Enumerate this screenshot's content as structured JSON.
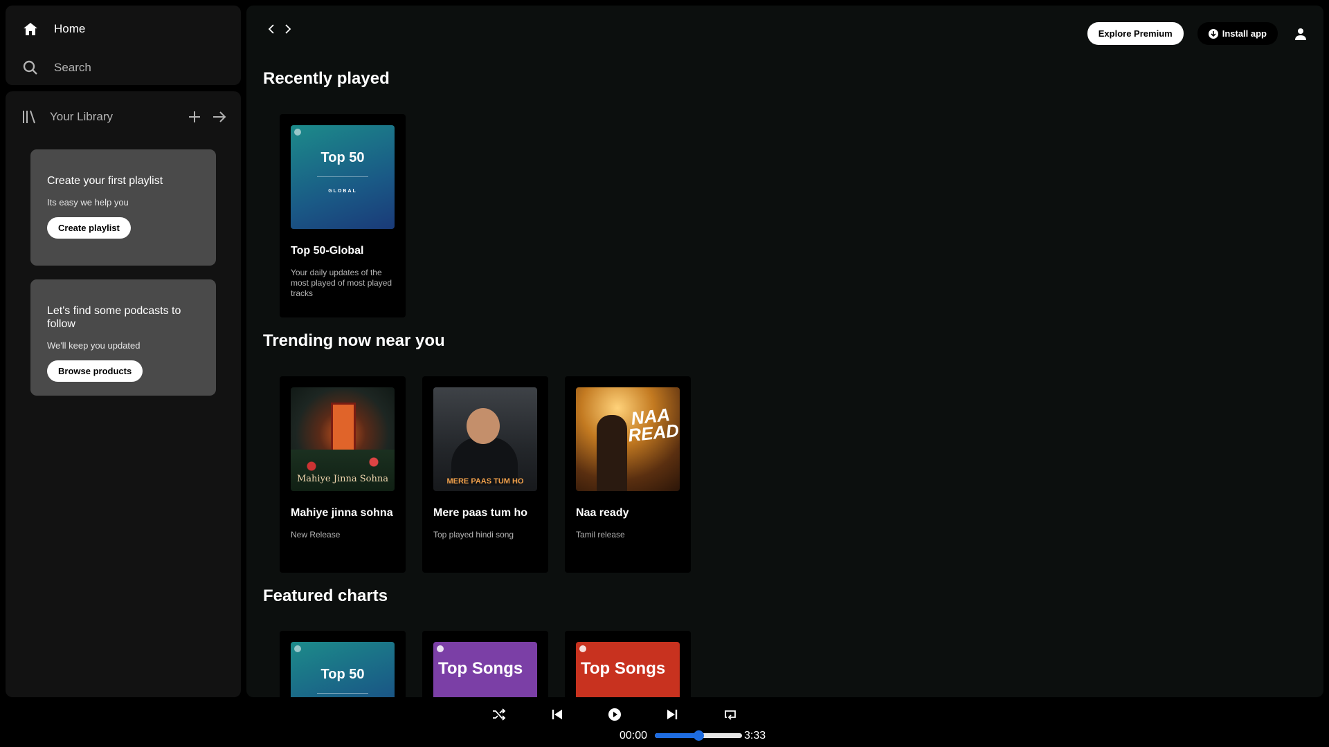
{
  "nav": {
    "home": "Home",
    "search": "Search"
  },
  "library": {
    "title": "Your Library",
    "playlist_card": {
      "title": "Create your first playlist",
      "subtitle": "Its easy we help you",
      "button": "Create playlist"
    },
    "podcast_card": {
      "title": "Let's find some podcasts to follow",
      "subtitle": "We'll keep you updated",
      "button": "Browse products"
    }
  },
  "header": {
    "premium": "Explore Premium",
    "install": "Install app"
  },
  "sections": {
    "recent": {
      "title": "Recently played",
      "cards": [
        {
          "title": "Top 50-Global",
          "desc": "Your daily updates of the most played of most played tracks",
          "art_text": "Top 50",
          "art_sub": "GLOBAL"
        }
      ]
    },
    "trending": {
      "title": "Trending now near you",
      "cards": [
        {
          "title": "Mahiye jinna sohna",
          "desc": "New Release",
          "art_text": "Mahiye Jinna Sohna"
        },
        {
          "title": "Mere paas tum ho",
          "desc": "Top played hindi song",
          "art_text": "MERE PAAS TUM HO"
        },
        {
          "title": "Naa ready",
          "desc": "Tamil release",
          "art_text": "NAA READY"
        }
      ]
    },
    "featured": {
      "title": "Featured charts",
      "cards": [
        {
          "art_text": "Top 50"
        },
        {
          "art_text": "Top Songs"
        },
        {
          "art_text": "Top Songs"
        }
      ]
    }
  },
  "player": {
    "current": "00:00",
    "total": "3:33",
    "progress": 0.5
  },
  "colors": {
    "accent": "#1e6ce0",
    "panel": "#121212",
    "card_box": "#4a4a4a"
  }
}
